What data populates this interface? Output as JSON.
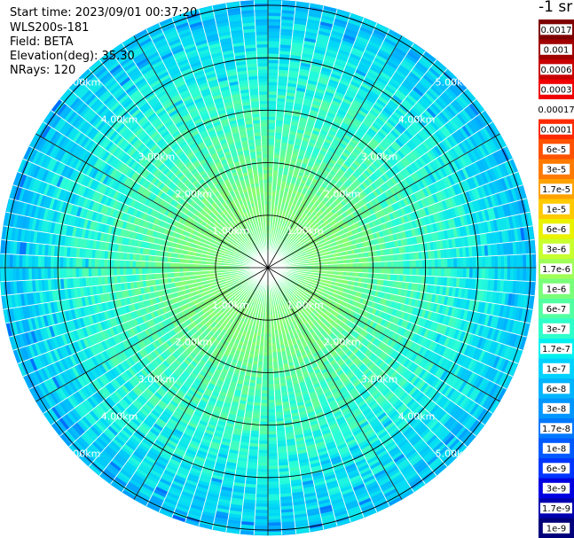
{
  "header": {
    "start_time": "Start time: 2023/09/01 00:37:20",
    "instrument": "WLS200s-181",
    "field": "Field: BETA",
    "elevation": "Elevation(deg): 35.30",
    "nrays": "NRays: 120"
  },
  "colorbar": {
    "unit": "-1 sr",
    "labels": [
      "0.0017",
      "0.001",
      "0.0006",
      "0.0003",
      "0.00017",
      "0.0001",
      "6e-5",
      "3e-5",
      "1.7e-5",
      "1e-5",
      "6e-6",
      "3e-6",
      "1.7e-6",
      "1e-6",
      "6e-7",
      "3e-7",
      "1.7e-7",
      "1e-7",
      "6e-8",
      "3e-8",
      "1.7e-8",
      "1e-8",
      "6e-9",
      "3e-9",
      "1.7e-9",
      "1e-9"
    ],
    "colors": [
      "#7f0000",
      "#a00000",
      "#c80000",
      "#f00000",
      "#ffffff",
      "#ff2a00",
      "#ff5200",
      "#ff7a00",
      "#ffa200",
      "#ffca00",
      "#eaf200",
      "#c8ff2e",
      "#a0ff56",
      "#7aff7a",
      "#52ffa2",
      "#2effca",
      "#00f0f0",
      "#00d2ff",
      "#00b4ff",
      "#0096ff",
      "#0078ff",
      "#005aff",
      "#0036ff",
      "#0000e0",
      "#0000b0",
      "#00007a"
    ]
  },
  "chart_data": {
    "type": "heatmap",
    "projection": "polar-ppi",
    "field": "BETA",
    "unit": "-1 sr",
    "n_rays": 120,
    "elevation_deg": 35.3,
    "range_rings_km": [
      1.0,
      2.0,
      3.0,
      4.0,
      5.0
    ],
    "ring_labels": [
      "1.00km",
      "2.00km",
      "3.00km",
      "4.00km",
      "5.00km"
    ],
    "max_range_km": 5.1,
    "spokes_deg": [
      0,
      30,
      60,
      90,
      120,
      150,
      180,
      210,
      240,
      270,
      300,
      330
    ],
    "radial_profile": [
      {
        "range_km": 0.0,
        "value": 2.2e-07
      },
      {
        "range_km": 0.5,
        "value": 2.8e-07
      },
      {
        "range_km": 1.0,
        "value": 3.5e-07
      },
      {
        "range_km": 1.5,
        "value": 3.2e-07
      },
      {
        "range_km": 2.0,
        "value": 2.4e-07
      },
      {
        "range_km": 2.5,
        "value": 1.9e-07
      },
      {
        "range_km": 3.0,
        "value": 1.6e-07
      },
      {
        "range_km": 3.5,
        "value": 1.3e-07
      },
      {
        "range_km": 4.0,
        "value": 1e-07
      },
      {
        "range_km": 4.5,
        "value": 7e-08
      },
      {
        "range_km": 5.0,
        "value": 4.5e-08
      }
    ]
  }
}
